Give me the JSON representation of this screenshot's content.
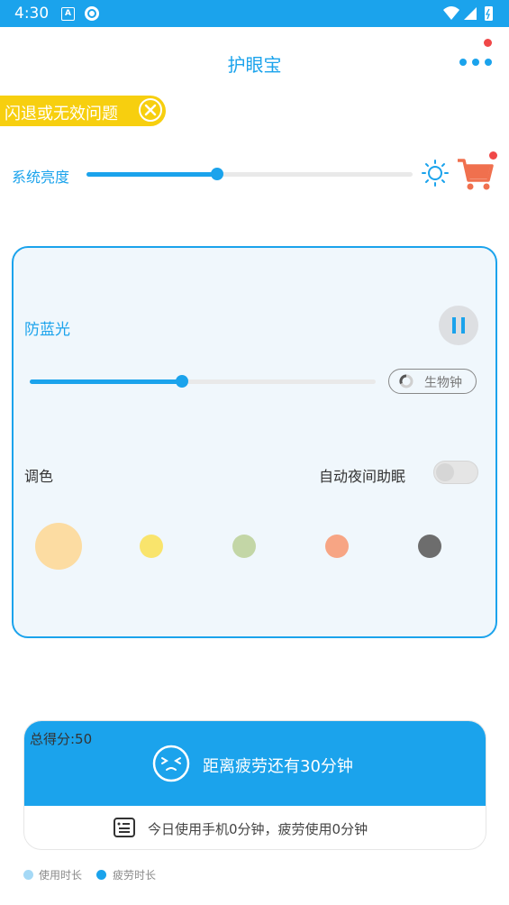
{
  "status_bar": {
    "time": "4:30",
    "a_icon_letter": "A"
  },
  "header": {
    "title": "护眼宝",
    "more_icon": "more-dots-icon"
  },
  "issue_banner": {
    "label": "闪退或无效问题"
  },
  "brightness": {
    "label": "系统亮度",
    "level_fraction": 0.4
  },
  "blue_light": {
    "title": "防蓝光",
    "level_fraction": 0.44,
    "biological_clock_label": "生物钟",
    "tint_label": "调色",
    "night_assist_label": "自动夜间助眠",
    "night_assist_on": false,
    "swatches": [
      "#fcdca2",
      "#f9e46c",
      "#c3d6a6",
      "#f7a584",
      "#6d6d6d"
    ],
    "selected_swatch": 0
  },
  "score": {
    "total": "总得分:50",
    "message": "距离疲劳还有30分钟",
    "today": "今日使用手机0分钟，疲劳使用0分钟"
  },
  "legend": {
    "usage_label": "使用时长",
    "usage_color": "#a5d9f6",
    "fatigue_label": "疲劳时长",
    "fatigue_color": "#1ba3ec"
  },
  "colors": {
    "accent": "#1ba3ec",
    "banner": "#f7cf0f",
    "cart": "#f0704e",
    "badge": "#f04848"
  }
}
